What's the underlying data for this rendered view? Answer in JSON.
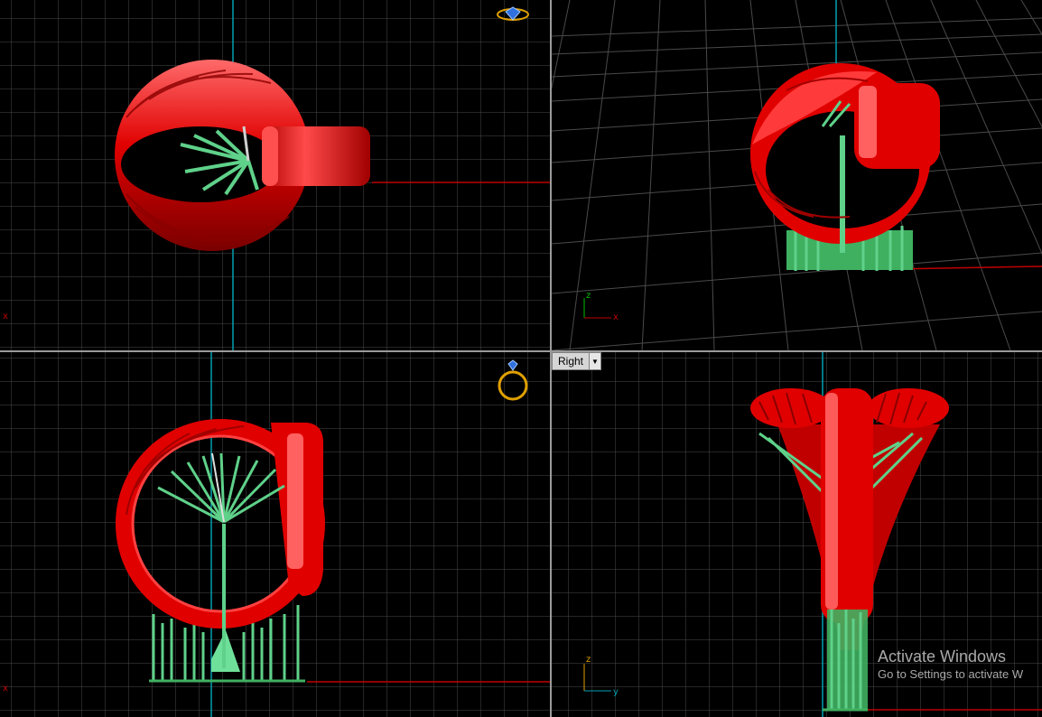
{
  "viewports": {
    "top": {
      "axis_marker": "x"
    },
    "perspective": {
      "axis_z": "z",
      "axis_x": "x"
    },
    "front": {
      "axis_marker": "x"
    },
    "right": {
      "name": "Right",
      "axis_z": "z",
      "axis_y": "y"
    }
  },
  "icons": {
    "top_gem": "ring-gem-top-icon",
    "front_ring": "ring-front-icon",
    "dropdown": "chevron-down-icon"
  },
  "watermark": {
    "title": "Activate Windows",
    "subtitle": "Go to Settings to activate W"
  },
  "colors": {
    "ring": "#e00000",
    "supports": "#5fd18a",
    "grid": "#5a5a5a",
    "axis_red": "#c00000",
    "axis_cyan": "#00a0b0",
    "icon_gold": "#e0a000"
  }
}
